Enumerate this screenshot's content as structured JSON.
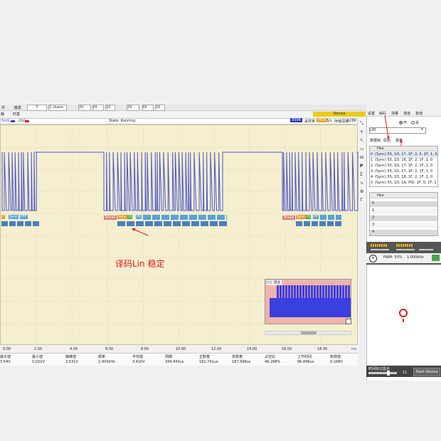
{
  "menu": {
    "items": [
      "件",
      "触发",
      "T",
      "2 chann",
      "2V",
      "DI",
      "10",
      "2V",
      "DI",
      "10"
    ]
  },
  "toolbar2": {
    "left_label": "静",
    "mode_label": "时基"
  },
  "scope": {
    "channel_a": "5mV",
    "channel_b": "ch2",
    "status": "State: Running",
    "rate_value": "500K",
    "sample_label": "采样率",
    "sample_value": "781K",
    "sample_unit": "S/s",
    "depth_label": "存储深度:",
    "depth_value": "128K",
    "time_ticks": [
      "0.00",
      "2.00",
      "4.00",
      "6.00",
      "8.00",
      "10.00",
      "12.00",
      "14.00",
      "16.00",
      "18.00"
    ],
    "time_unit": "ms",
    "annotation": "译码Lin 稳定",
    "decode_groups": [
      {
        "label": "Break",
        "items": [
          "F",
          "Sync",
          "FFF"
        ]
      },
      {
        "label": "Break",
        "items": [
          "Sync",
          "ID",
          "PP"
        ]
      },
      {
        "label": "Break",
        "items": [
          "Sync",
          "ID",
          "PP"
        ]
      }
    ],
    "overview_title": "I²C 预览"
  },
  "measurements": [
    {
      "label": "最大值",
      "value": "3.54V"
    },
    {
      "label": "最小值",
      "value": "0.022V"
    },
    {
      "label": "峰峰值",
      "value": "3.531V"
    },
    {
      "label": "频率",
      "value": "2.903kHz"
    },
    {
      "label": "平均值",
      "value": "3.410V"
    },
    {
      "label": "周期",
      "value": "349.443us"
    },
    {
      "label": "正脉宽",
      "value": "161.741us"
    },
    {
      "label": "负脉宽",
      "value": "187.699us"
    },
    {
      "label": "占空比",
      "value": "46.288%"
    },
    {
      "label": "上升时间",
      "value": "96.846us"
    },
    {
      "label": "有效值",
      "value": "0.168V"
    }
  ],
  "right_panel": {
    "device_label": "Device",
    "tabs": [
      "设置",
      "解码",
      "测量",
      "通道",
      "其他"
    ],
    "radio_on": "开",
    "radio_off": "关",
    "protocol_value": "LIN",
    "subtabs": [
      "数据帧",
      "原始",
      "报表"
    ],
    "table_header": "Hex",
    "rows": [
      {
        "index": "0",
        "text": "(Sync) 55, 1D, 17, 1F, 2, 0, 1F, 1, 0"
      },
      {
        "index": "1",
        "text": "(Sync) 55, 1D, 16, 1F, 2, 1F, 1, 0"
      },
      {
        "index": "2",
        "text": "(Sync) 55, 1D, 17, 1F, 2, 1F, 1, 0"
      },
      {
        "index": "3",
        "text": "(Sync) 55, 1D, 17, 1F, 2, 1F, 1, 0"
      },
      {
        "index": "4",
        "text": "(Sync) 55, 1D, 18, 1F, 2, 1F, 1, 0"
      },
      {
        "index": "5",
        "text": "(Sync) 55, 1D, 1A, PID, 1F, 0, 1F, 1"
      }
    ],
    "table2_header": "Hex",
    "table2_rows": [
      "0",
      "1",
      "2",
      "3",
      "4"
    ],
    "pwm_text": "PWM: 50%",
    "freq_text": "1.000kHz",
    "bottom_slider_label": "时间标注显示",
    "start_device": "Start Device",
    "slider_value": "11"
  },
  "colors": {
    "scope_bg": "#f5efcf",
    "trace": "#4a56d0",
    "accent_red": "#e01818",
    "overview_bg": "#f0b3ab"
  }
}
